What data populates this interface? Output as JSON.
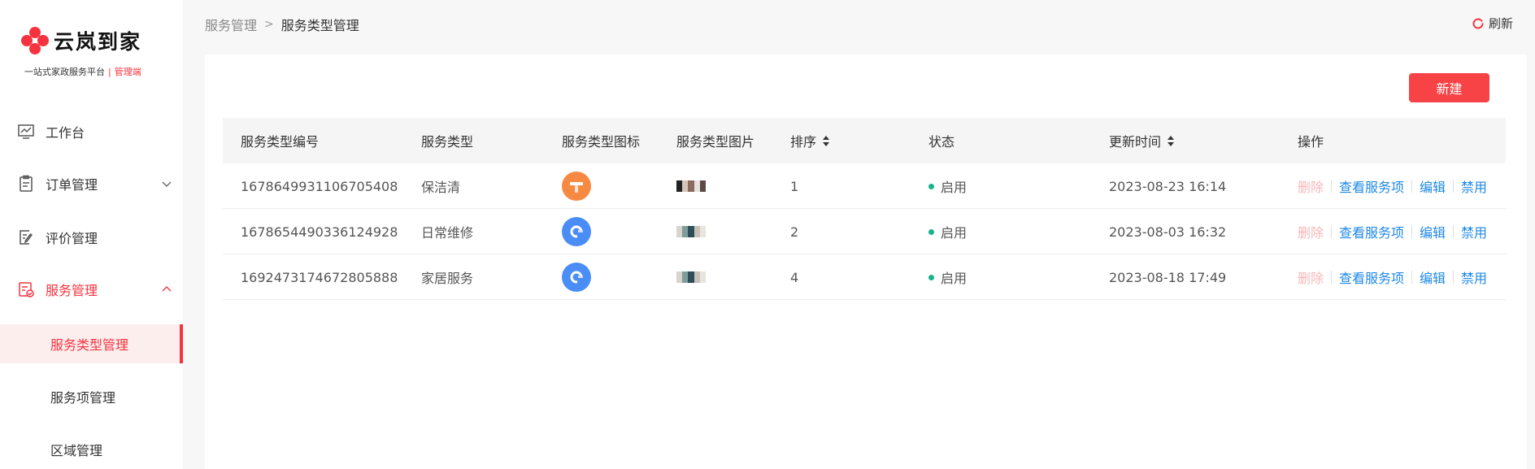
{
  "brand": {
    "name": "云岚到家",
    "slogan": "一站式家政服务平台",
    "slogan_sep": "|",
    "admin_label": "管理端",
    "color": "#f5333f"
  },
  "sidebar": {
    "items": [
      {
        "label": "工作台",
        "icon": "dashboard-icon"
      },
      {
        "label": "订单管理",
        "icon": "order-icon",
        "expandable": true,
        "expanded": false
      },
      {
        "label": "评价管理",
        "icon": "review-icon"
      },
      {
        "label": "服务管理",
        "icon": "service-icon",
        "expandable": true,
        "expanded": true,
        "active": true
      }
    ],
    "sub_items": [
      {
        "label": "服务类型管理",
        "active": true
      },
      {
        "label": "服务项管理",
        "active": false
      },
      {
        "label": "区域管理",
        "active": false
      }
    ]
  },
  "header": {
    "breadcrumb": [
      "服务管理",
      "服务类型管理"
    ],
    "breadcrumb_sep": ">",
    "refresh_label": "刷新"
  },
  "toolbar": {
    "new_label": "新建"
  },
  "table": {
    "columns": [
      "服务类型编号",
      "服务类型",
      "服务类型图标",
      "服务类型图片",
      "排序",
      "状态",
      "更新时间",
      "操作"
    ],
    "rows": [
      {
        "id": "1678649931106705408",
        "type": "保洁清",
        "icon": "cleaning-icon",
        "icon_color": "#f78a42",
        "sort": "1",
        "status": "启用",
        "updated": "2023-08-23 16:14"
      },
      {
        "id": "1678654490336124928",
        "type": "日常维修",
        "icon": "repair-icon",
        "icon_color": "#4a8df6",
        "sort": "2",
        "status": "启用",
        "updated": "2023-08-03 16:32"
      },
      {
        "id": "1692473174672805888",
        "type": "家居服务",
        "icon": "repair-icon",
        "icon_color": "#4a8df6",
        "sort": "4",
        "status": "启用",
        "updated": "2023-08-18 17:49"
      }
    ],
    "actions": {
      "delete": "删除",
      "view_items": "查看服务项",
      "edit": "编辑",
      "disable": "禁用"
    },
    "status_color": "#19b38a"
  }
}
